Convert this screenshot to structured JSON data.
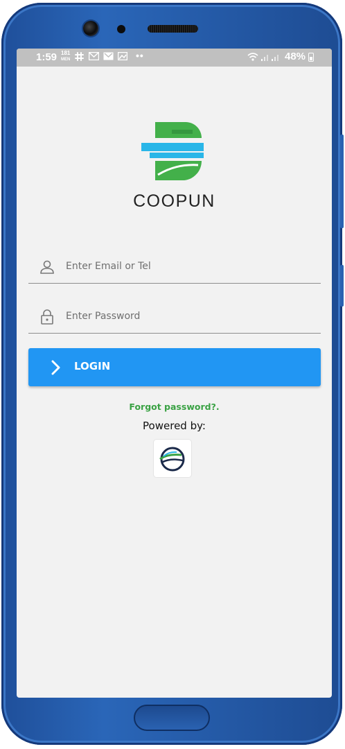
{
  "status_bar": {
    "time": "1:59",
    "small_top": "181",
    "small_bottom": "MEN",
    "dots": "••",
    "battery": "48%"
  },
  "app": {
    "brand_name": "COOPUN",
    "email_placeholder": "Enter Email or Tel",
    "password_placeholder": "Enter Password",
    "login_label": "LOGIN",
    "forgot_label": "Forgot password?.",
    "powered_by_label": "Powered by:"
  },
  "colors": {
    "primary": "#2196f3",
    "accent_green": "#3aa244",
    "logo_cyan": "#29b6e8",
    "logo_green": "#43b04a",
    "phone_body": "#2a62b1"
  },
  "icons": {
    "email_field": "user-icon",
    "password_field": "lock-icon",
    "login_button": "chevron-right-icon"
  }
}
